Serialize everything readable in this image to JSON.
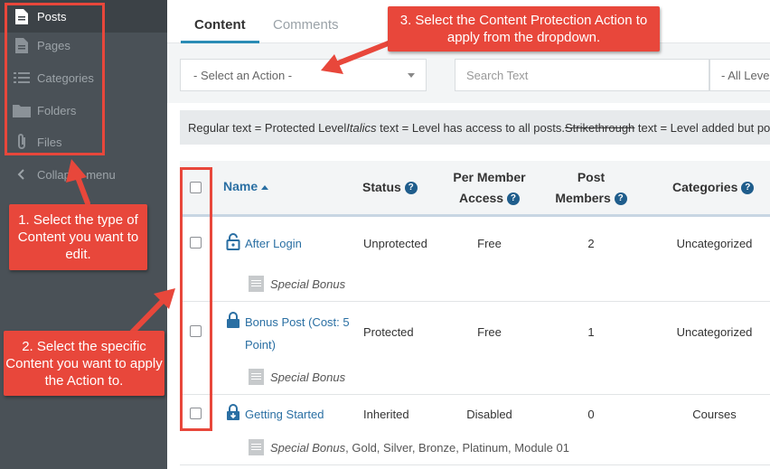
{
  "sidebar": {
    "items": [
      {
        "label": "Posts",
        "icon": "post-doc-icon",
        "active": true
      },
      {
        "label": "Pages",
        "icon": "page-doc-icon",
        "active": false
      },
      {
        "label": "Categories",
        "icon": "list-icon",
        "active": false
      },
      {
        "label": "Folders",
        "icon": "folder-icon",
        "active": false
      },
      {
        "label": "Files",
        "icon": "paperclip-icon",
        "active": false
      }
    ],
    "collapse_label": "Collapse menu"
  },
  "tabs": [
    {
      "label": "Content",
      "active": true
    },
    {
      "label": "Comments",
      "active": false
    }
  ],
  "filters": {
    "action_select": "- Select an Action -",
    "search_placeholder": "Search Text",
    "levels_select": "- All Levels"
  },
  "legend": {
    "regular": "Regular text = Protected Level",
    "italic_word": "Italics",
    "italic_rest": " text = Level has access to all posts.",
    "strike_word": "Strikethrough",
    "strike_rest": " text = Level added but posts"
  },
  "table": {
    "headers": {
      "name": "Name",
      "status": "Status",
      "per_member_1": "Per Member",
      "per_member_2": "Access",
      "post_members_1": "Post",
      "post_members_2": "Members",
      "categories": "Categories"
    },
    "rows": [
      {
        "title": "After Login",
        "lock": "unlocked",
        "status": "Unprotected",
        "access": "Free",
        "members": "2",
        "categories": "Uncategorized",
        "levels_italic": "Special Bonus",
        "levels_rest": ""
      },
      {
        "title_line1": "Bonus Post (Cost: 5",
        "title_line2": "Point)",
        "lock": "locked",
        "status": "Protected",
        "access": "Free",
        "members": "1",
        "categories": "Uncategorized",
        "levels_italic": "Special Bonus",
        "levels_rest": ""
      },
      {
        "title": "Getting Started",
        "lock": "inherited",
        "status": "Inherited",
        "access": "Disabled",
        "members": "0",
        "categories": "Courses",
        "levels_italic": "Special Bonus",
        "levels_rest": ", Gold, Silver, Bronze, Platinum, Module 01"
      }
    ]
  },
  "annotations": {
    "callout1": "1. Select the type of Content you want to edit.",
    "callout2": "2. Select the specific Content you want to apply the Action to.",
    "callout3": "3. Select the Content Protection Action to apply from the dropdown."
  },
  "colors": {
    "accent_red": "#e8473b",
    "link_blue": "#2a6fa3",
    "sidebar_bg": "#4a5157"
  }
}
